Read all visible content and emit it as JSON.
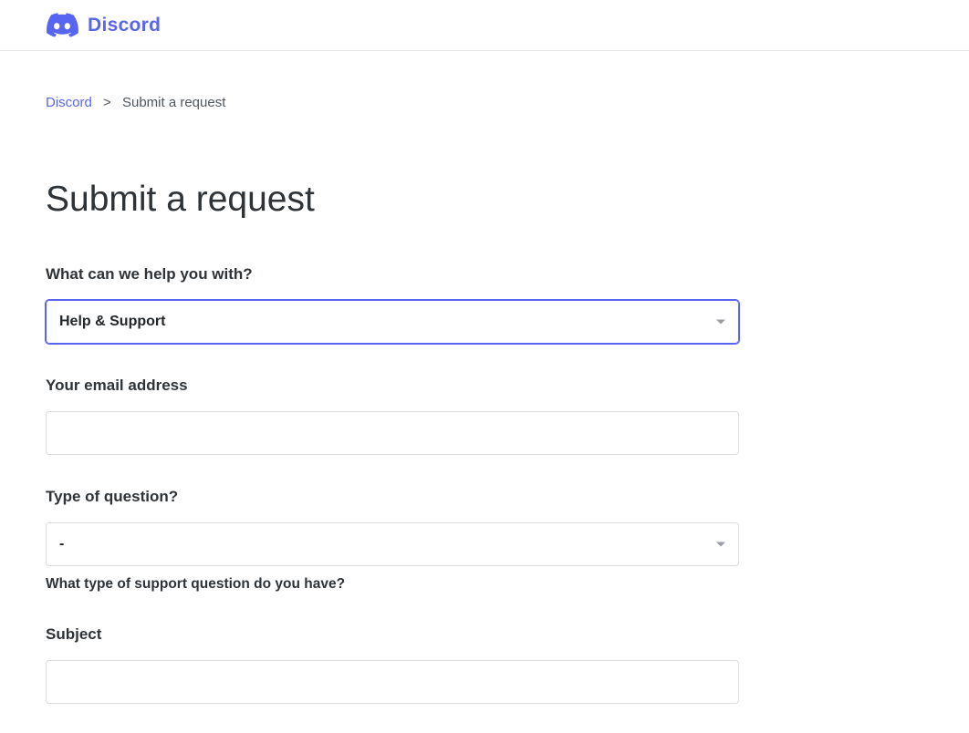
{
  "header": {
    "brand": "Discord"
  },
  "breadcrumb": {
    "home_label": "Discord",
    "separator": ">",
    "current": "Submit a request"
  },
  "page": {
    "title": "Submit a request"
  },
  "form": {
    "help_with": {
      "label": "What can we help you with?",
      "selected": "Help & Support"
    },
    "email": {
      "label": "Your email address",
      "value": ""
    },
    "question_type": {
      "label": "Type of question?",
      "selected": "-",
      "help_text": "What type of support question do you have?"
    },
    "subject": {
      "label": "Subject",
      "value": ""
    }
  }
}
